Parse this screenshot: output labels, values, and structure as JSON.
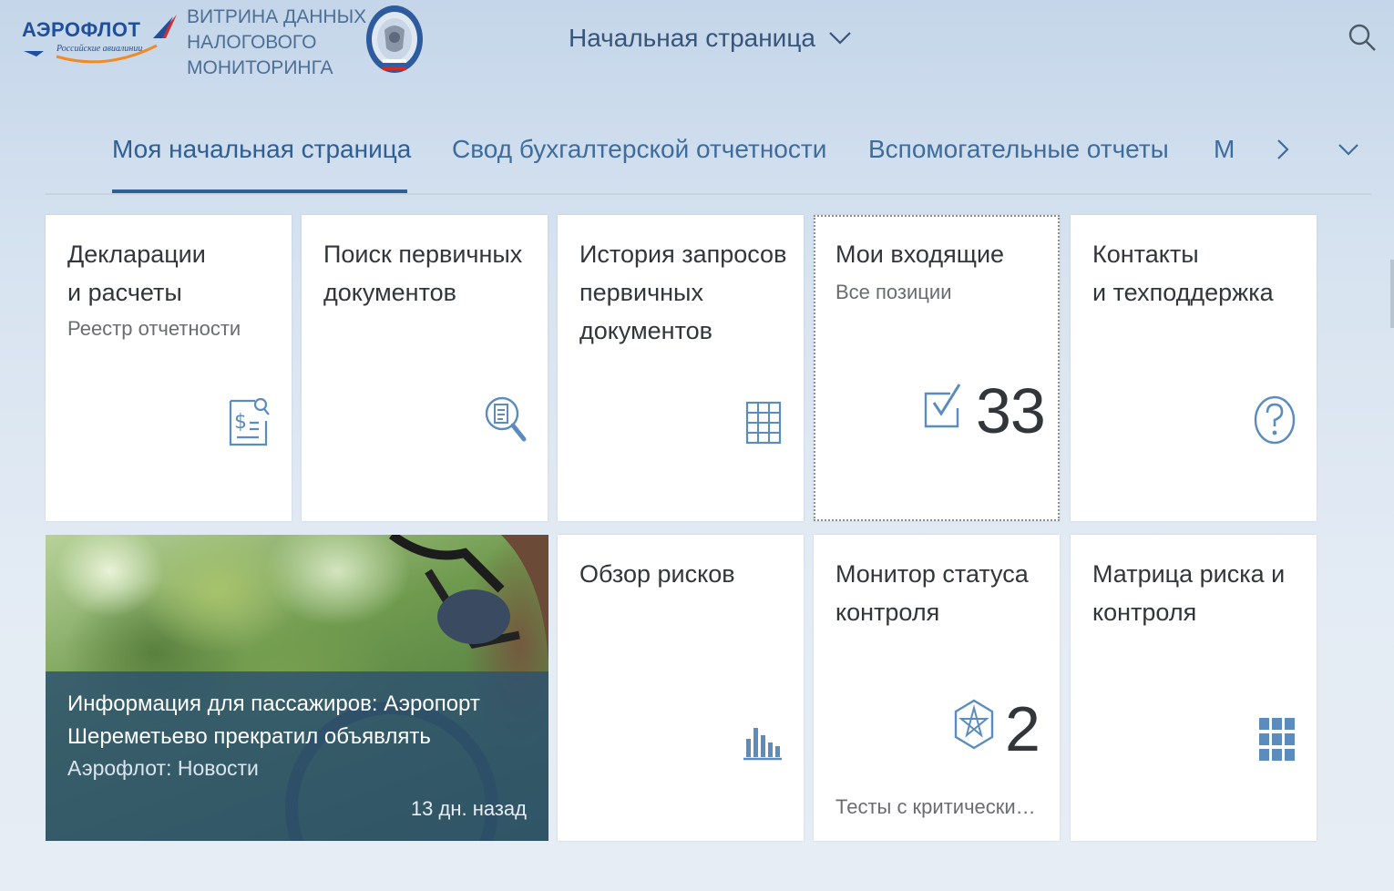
{
  "header": {
    "brand_name": "АЭРОФЛОТ",
    "brand_subtitle": "Российские авиалинии",
    "app_title_lines": [
      "Витрина данных",
      "налогового",
      "мониторинга"
    ],
    "page_selector": "Начальная страница"
  },
  "tabs": [
    {
      "label": "Моя начальная страница",
      "active": true
    },
    {
      "label": "Свод бухгалтерской отчетности",
      "active": false
    },
    {
      "label": "Вспомогательные отчеты",
      "active": false
    },
    {
      "label": "М",
      "active": false
    }
  ],
  "tiles": {
    "declarations": {
      "title_lines": [
        "Декларации",
        "и расчеты"
      ],
      "subtitle": "Реестр отчетности",
      "icon": "tax-document-icon"
    },
    "primary_search": {
      "title_lines": [
        "Поиск первичных",
        "документов"
      ],
      "icon": "document-search-icon"
    },
    "request_history": {
      "title_lines": [
        "История запросов",
        "первичных",
        "документов"
      ],
      "icon": "table-grid-icon"
    },
    "inbox": {
      "title_lines": [
        "Мои входящие"
      ],
      "subtitle": "Все позиции",
      "count": "33",
      "icon": "checkbox-icon"
    },
    "contacts": {
      "title_lines": [
        "Контакты",
        "и техподдержка"
      ],
      "icon": "help-icon"
    },
    "risk_overview": {
      "title_lines": [
        "Обзор рисков"
      ],
      "icon": "bar-chart-icon"
    },
    "control_monitor": {
      "title_lines": [
        "Монитор статуса",
        "контроля"
      ],
      "count": "2",
      "footer": "Тесты с критически…",
      "icon": "pentagram-icon"
    },
    "risk_matrix": {
      "title_lines": [
        "Матрица риска и",
        "контроля"
      ],
      "icon": "grid-9-icon"
    }
  },
  "news": {
    "title": "Информация для пассажиров: Аэропорт Шереметьево прекратил объявлять",
    "source": "Аэрофлот: Новости",
    "time": "13 дн. назад"
  },
  "colors": {
    "accent": "#2f6093",
    "tab_text": "#3e6c9c",
    "icon": "#5b8cbd",
    "news_overlay": "#2c5070"
  }
}
